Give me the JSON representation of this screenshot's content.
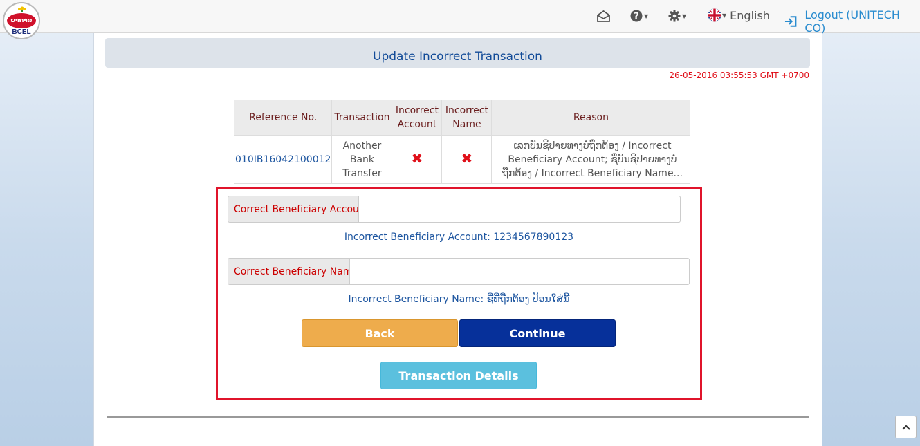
{
  "brand": {
    "logo_text": "BCEL",
    "logo_lao": "ບາຄາລ"
  },
  "nav": {
    "language": "English",
    "logout": "Logout (UNITECH CO)",
    "icons": [
      "mail-icon",
      "help-icon",
      "gear-icon",
      "uk-flag-icon",
      "logout-icon"
    ]
  },
  "page": {
    "title": "Update Incorrect Transaction",
    "timestamp": "26-05-2016 03:55:53 GMT +0700"
  },
  "table": {
    "headers": {
      "ref": "Reference No.",
      "transaction": "Transaction",
      "incorrect_account_1": "Incorrect",
      "incorrect_account_2": "Account",
      "incorrect_name_1": "Incorrect",
      "incorrect_name_2": "Name",
      "reason": "Reason"
    },
    "row": {
      "ref": "010IB16042100012",
      "transaction_1": "Another",
      "transaction_2": "Bank",
      "transaction_3": "Transfer",
      "incorrect_account": "✖",
      "incorrect_name": "✖",
      "reason_1": "ເລກບັນຊີປາຍທາງບໍ່ຖືກຕ້ອງ / Incorrect",
      "reason_2": "Beneficiary Account; ຊື່ບັນຊີປາຍທາງບໍ່",
      "reason_3": "ຖືກຕ້ອງ / Incorrect Beneficiary Name..."
    }
  },
  "form": {
    "account_label": "Correct Beneficiary Account",
    "account_value": "",
    "account_hint": "Incorrect Beneficiary Account: 1234567890123",
    "name_label": "Correct Beneficiary Name",
    "name_value": "",
    "name_hint": "Incorrect Beneficiary Name: ຊື່ທີ່ຖືກຕ້ອງ ປ້ອນໃສ່ນີ້",
    "back": "Back",
    "continue": "Continue",
    "details": "Transaction Details"
  },
  "colors": {
    "accent_blue": "#06309a",
    "back_orange": "#eeac4c",
    "details_cyan": "#5bc0de",
    "alert_red": "#e0101a",
    "highlight_box": "#e0142b"
  }
}
